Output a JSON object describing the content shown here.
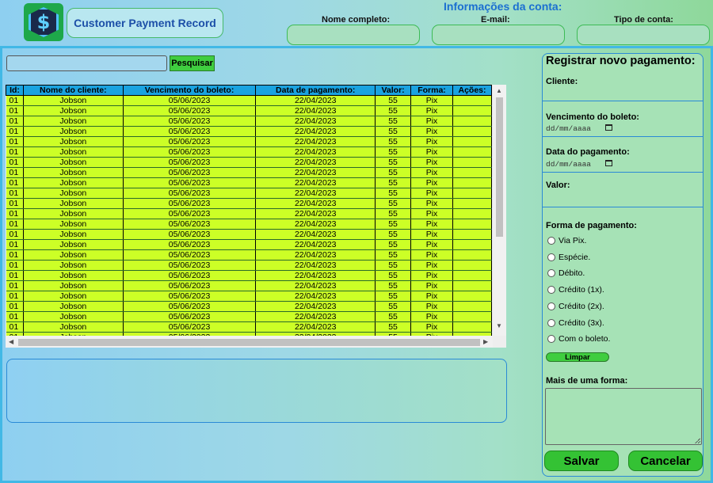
{
  "header": {
    "app_title": "Customer Payment Record",
    "logo_icon": "dollar-icon",
    "account": {
      "title": "Informações da conta:",
      "full_name_label": "Nome completo:",
      "email_label": "E-mail:",
      "account_type_label": "Tipo de conta:"
    }
  },
  "search": {
    "value": "",
    "button_label": "Pesquisar"
  },
  "table": {
    "columns": [
      "Id:",
      "Nome do cliente:",
      "Vencimento do boleto:",
      "Data de pagamento:",
      "Valor:",
      "Forma:",
      "Ações:"
    ],
    "rows": [
      [
        "01",
        "Jobson",
        "05/06/2023",
        "22/04/2023",
        "55",
        "Pix",
        ""
      ],
      [
        "01",
        "Jobson",
        "05/06/2023",
        "22/04/2023",
        "55",
        "Pix",
        ""
      ],
      [
        "01",
        "Jobson",
        "05/06/2023",
        "22/04/2023",
        "55",
        "Pix",
        ""
      ],
      [
        "01",
        "Jobson",
        "05/06/2023",
        "22/04/2023",
        "55",
        "Pix",
        ""
      ],
      [
        "01",
        "Jobson",
        "05/06/2023",
        "22/04/2023",
        "55",
        "Pix",
        ""
      ],
      [
        "01",
        "Jobson",
        "05/06/2023",
        "22/04/2023",
        "55",
        "Pix",
        ""
      ],
      [
        "01",
        "Jobson",
        "05/06/2023",
        "22/04/2023",
        "55",
        "Pix",
        ""
      ],
      [
        "01",
        "Jobson",
        "05/06/2023",
        "22/04/2023",
        "55",
        "Pix",
        ""
      ],
      [
        "01",
        "Jobson",
        "05/06/2023",
        "22/04/2023",
        "55",
        "Pix",
        ""
      ],
      [
        "01",
        "Jobson",
        "05/06/2023",
        "22/04/2023",
        "55",
        "Pix",
        ""
      ],
      [
        "01",
        "Jobson",
        "05/06/2023",
        "22/04/2023",
        "55",
        "Pix",
        ""
      ],
      [
        "01",
        "Jobson",
        "05/06/2023",
        "22/04/2023",
        "55",
        "Pix",
        ""
      ],
      [
        "01",
        "Jobson",
        "05/06/2023",
        "22/04/2023",
        "55",
        "Pix",
        ""
      ],
      [
        "01",
        "Jobson",
        "05/06/2023",
        "22/04/2023",
        "55",
        "Pix",
        ""
      ],
      [
        "01",
        "Jobson",
        "05/06/2023",
        "22/04/2023",
        "55",
        "Pix",
        ""
      ],
      [
        "01",
        "Jobson",
        "05/06/2023",
        "22/04/2023",
        "55",
        "Pix",
        ""
      ],
      [
        "01",
        "Jobson",
        "05/06/2023",
        "22/04/2023",
        "55",
        "Pix",
        ""
      ],
      [
        "01",
        "Jobson",
        "05/06/2023",
        "22/04/2023",
        "55",
        "Pix",
        ""
      ],
      [
        "01",
        "Jobson",
        "05/06/2023",
        "22/04/2023",
        "55",
        "Pix",
        ""
      ],
      [
        "01",
        "Jobson",
        "05/06/2023",
        "22/04/2023",
        "55",
        "Pix",
        ""
      ],
      [
        "01",
        "Jobson",
        "05/06/2023",
        "22/04/2023",
        "55",
        "Pix",
        ""
      ],
      [
        "01",
        "Jobson",
        "05/06/2023",
        "22/04/2023",
        "55",
        "Pix",
        ""
      ],
      [
        "01",
        "Jobson",
        "05/06/2023",
        "22/04/2023",
        "55",
        "Pix",
        ""
      ],
      [
        "01",
        "Jobson",
        "05/06/2023",
        "22/04/2023",
        "55",
        "Pix",
        ""
      ]
    ]
  },
  "form": {
    "title": "Registrar novo pagamento:",
    "client_label": "Cliente:",
    "due_date_label": "Vencimento do boleto:",
    "due_date_placeholder": "dd/mm/aaaa",
    "payment_date_label": "Data do pagamento:",
    "payment_date_placeholder": "dd/mm/aaaa",
    "amount_label": "Valor:",
    "payment_method_label": "Forma de pagamento:",
    "payment_methods": [
      "Via Pix.",
      "Espécie.",
      "Débito.",
      "Crédito (1x).",
      "Crédito (2x).",
      "Crédito (3x).",
      "Com o boleto."
    ],
    "clear_label": "Limpar",
    "multi_method_label": "Mais de uma forma:",
    "save_label": "Salvar",
    "cancel_label": "Cancelar"
  },
  "colors": {
    "table_header": "#1aa3e0",
    "table_row": "#ccff26",
    "button_green": "#34c234",
    "accent_blue": "#1b6fd1"
  }
}
